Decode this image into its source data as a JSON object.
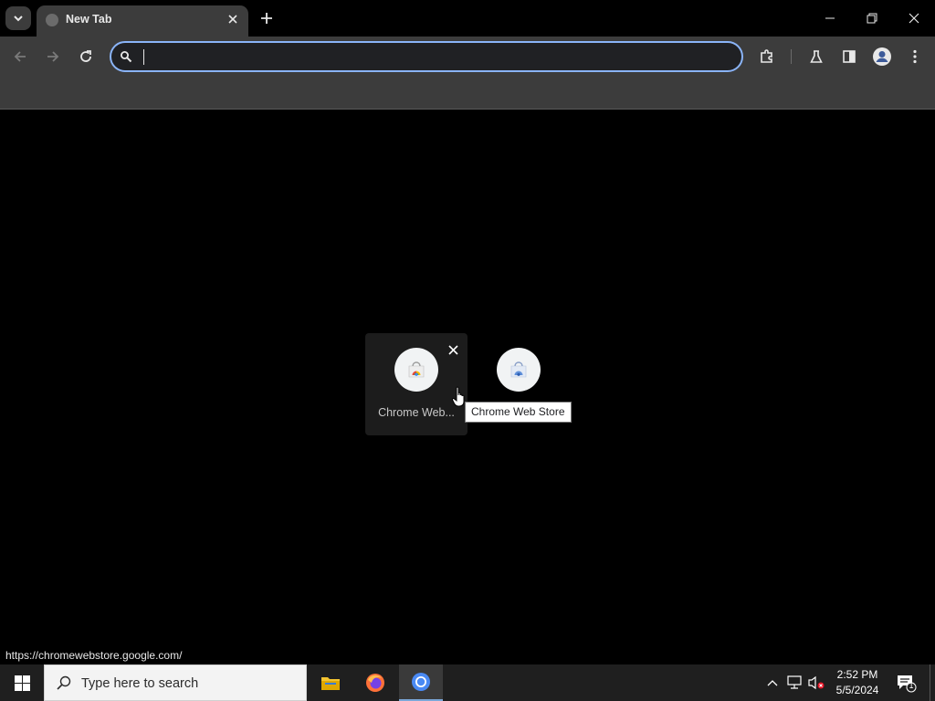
{
  "browser": {
    "tab": {
      "title": "New Tab"
    },
    "omnibox": {
      "value": "",
      "placeholder": ""
    }
  },
  "shortcuts": [
    {
      "label": "Chrome Web..."
    },
    {
      "label": ""
    }
  ],
  "tooltip": {
    "text": "Chrome Web Store"
  },
  "status_bar": {
    "url": "https://chromewebstore.google.com/"
  },
  "taskbar": {
    "search_placeholder": "Type here to search",
    "clock": {
      "time": "2:52 PM",
      "date": "5/5/2024"
    },
    "notification_count": "1"
  },
  "colors": {
    "accent": "#8ab4f8",
    "toolbar": "#3c3c3c",
    "content_bg": "#000000",
    "taskbar": "#1f1f1f"
  }
}
